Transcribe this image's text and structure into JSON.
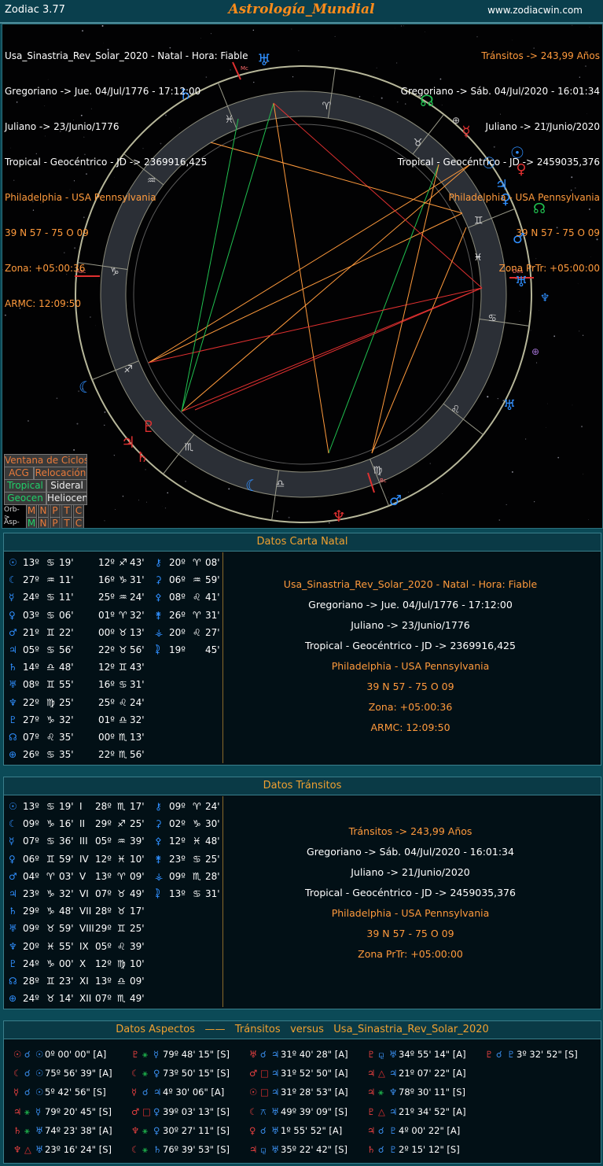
{
  "titlebar": {
    "app": "Zodiac 3.77",
    "title": "Astrología_Mundial",
    "url": "www.zodiacwin.com"
  },
  "natal_header": [
    "Usa_Sinastria_Rev_Solar_2020 - Natal - Hora: Fiable",
    "Gregoriano -> Jue. 04/Jul/1776 - 17:12:00",
    "Juliano -> 23/Junio/1776",
    "Tropical - Geocéntrico - JD -> 2369916,425",
    "Philadelphia - USA Pennsylvania",
    "39 N 57 - 75 O 09",
    "Zona: +05:00:36",
    "ARMC: 12:09:50"
  ],
  "transit_header": [
    "Tránsitos -> 243,99 Años",
    "Gregoriano -> Sáb. 04/Jul/2020 - 16:01:34",
    "Juliano -> 21/Junio/2020",
    "Tropical - Geocéntrico - JD -> 2459035,376",
    "Philadelphia - USA Pennsylvania",
    "39 N 57 - 75 O 09",
    "Zona PrTr: +05:00:00"
  ],
  "wheel_labels": {
    "mc": "Mc",
    "asc": "Asc",
    "des": "Des",
    "bc": "Bc"
  },
  "buttons": {
    "ventana": "Ventana de Ciclos",
    "acg": "ACG",
    "relocacion": "Relocación",
    "tropical": "Tropical",
    "sideral": "Sideral",
    "geocen": "Geocen",
    "heliocen": "Heliocen",
    "orb": "Orb->",
    "asp": "Asp->",
    "m": "M",
    "n": "N",
    "p": "P",
    "t": "T",
    "c": "C"
  },
  "natal_panel": {
    "title": "Datos Carta Natal",
    "col1": [
      [
        "☉",
        "13º",
        "♋",
        "19'"
      ],
      [
        "☾",
        "27º",
        "♒",
        "11'"
      ],
      [
        "☿",
        "24º",
        "♋",
        "11'"
      ],
      [
        "♀",
        "03º",
        "♋",
        "06'"
      ],
      [
        "♂",
        "21º",
        "♊",
        "22'"
      ],
      [
        "♃",
        "05º",
        "♋",
        "56'"
      ],
      [
        "♄",
        "14º",
        "♎",
        "48'"
      ],
      [
        "♅",
        "08º",
        "♊",
        "55'"
      ],
      [
        "♆",
        "22º",
        "♍",
        "25'"
      ],
      [
        "♇",
        "27º",
        "♑",
        "32'"
      ],
      [
        "☊",
        "07º",
        "♌",
        "35'"
      ],
      [
        "⊕",
        "26º",
        "♋",
        "35'"
      ]
    ],
    "col2": [
      [
        "12º",
        "♐",
        "43'"
      ],
      [
        "16º",
        "♑",
        "31'"
      ],
      [
        "25º",
        "♒",
        "24'"
      ],
      [
        "01º",
        "♈",
        "32'"
      ],
      [
        "00º",
        "♉",
        "13'"
      ],
      [
        "22º",
        "♉",
        "56'"
      ],
      [
        "12º",
        "♊",
        "43'"
      ],
      [
        "16º",
        "♋",
        "31'"
      ],
      [
        "25º",
        "♌",
        "24'"
      ],
      [
        "01º",
        "♎",
        "32'"
      ],
      [
        "00º",
        "♏",
        "13'"
      ],
      [
        "22º",
        "♏",
        "56'"
      ]
    ],
    "col3": [
      [
        "⚷",
        "20º",
        "♈",
        "08'"
      ],
      [
        "⚳",
        "06º",
        "♒",
        "59'"
      ],
      [
        "⚴",
        "08º",
        "♌",
        "41'"
      ],
      [
        "⚵",
        "26º",
        "♈",
        "31'"
      ],
      [
        "⚶",
        "20º",
        "♌",
        "27'"
      ],
      [
        "⯝",
        "19º",
        "",
        "45'"
      ]
    ],
    "info": [
      "Usa_Sinastria_Rev_Solar_2020 - Natal - Hora: Fiable",
      "Gregoriano -> Jue. 04/Jul/1776 - 17:12:00",
      "Juliano -> 23/Junio/1776",
      "Tropical - Geocéntrico - JD -> 2369916,425",
      "Philadelphia - USA Pennsylvania",
      "39 N 57 - 75 O 09",
      "Zona: +05:00:36",
      "ARMC: 12:09:50"
    ]
  },
  "transit_panel": {
    "title": "Datos Tránsitos",
    "col1": [
      [
        "☉",
        "13º",
        "♋",
        "19'"
      ],
      [
        "☾",
        "09º",
        "♑",
        "16'"
      ],
      [
        "☿",
        "07º",
        "♋",
        "36'"
      ],
      [
        "♀",
        "06º",
        "♊",
        "59'"
      ],
      [
        "♂",
        "04º",
        "♈",
        "03'"
      ],
      [
        "♃",
        "23º",
        "♑",
        "32'"
      ],
      [
        "♄",
        "29º",
        "♑",
        "48'"
      ],
      [
        "♅",
        "09º",
        "♉",
        "59'"
      ],
      [
        "♆",
        "20º",
        "♓",
        "55'"
      ],
      [
        "♇",
        "24º",
        "♑",
        "00'"
      ],
      [
        "☊",
        "28º",
        "♊",
        "23'"
      ],
      [
        "⊕",
        "24º",
        "♉",
        "14'"
      ]
    ],
    "col2": [
      [
        "I",
        "28º",
        "♏",
        "17'"
      ],
      [
        "II",
        "29º",
        "♐",
        "25'"
      ],
      [
        "III",
        "05º",
        "♒",
        "39'"
      ],
      [
        "IV",
        "12º",
        "♓",
        "10'"
      ],
      [
        "V",
        "13º",
        "♈",
        "09'"
      ],
      [
        "VI",
        "07º",
        "♉",
        "49'"
      ],
      [
        "VII",
        "28º",
        "♉",
        "17'"
      ],
      [
        "VIII",
        "29º",
        "♊",
        "25'"
      ],
      [
        "IX",
        "05º",
        "♌",
        "39'"
      ],
      [
        "X",
        "12º",
        "♍",
        "10'"
      ],
      [
        "XI",
        "13º",
        "♎",
        "09'"
      ],
      [
        "XII",
        "07º",
        "♏",
        "49'"
      ]
    ],
    "col3": [
      [
        "⚷",
        "09º",
        "♈",
        "24'"
      ],
      [
        "⚳",
        "02º",
        "♑",
        "30'"
      ],
      [
        "⚴",
        "12º",
        "♓",
        "48'"
      ],
      [
        "⚵",
        "23º",
        "♋",
        "25'"
      ],
      [
        "⚶",
        "09º",
        "♏",
        "28'"
      ],
      [
        "⯝",
        "13º",
        "♋",
        "31'"
      ]
    ],
    "info": [
      "Tránsitos -> 243,99 Años",
      "Gregoriano -> Sáb. 04/Jul/2020 - 16:01:34",
      "Juliano -> 21/Junio/2020",
      "Tropical - Geocéntrico - JD -> 2459035,376",
      "Philadelphia - USA Pennsylvania",
      "39 N 57 - 75 O 09",
      "Zona PrTr: +05:00:00"
    ]
  },
  "aspects_panel": {
    "title_a": "Datos Aspectos",
    "title_sep": "——",
    "title_b": "Tránsitos",
    "title_c": "versus",
    "title_d": "Usa_Sinastria_Rev_Solar_2020",
    "rows": [
      [
        [
          "☉",
          "☌",
          "☉",
          "0º 00' 00\" [A]"
        ],
        [
          "♇",
          "⚹",
          "☿",
          "79º 48' 15\" [S]"
        ],
        [
          "♅",
          "☌",
          "♃",
          "31º 40' 28\" [A]"
        ],
        [
          "♇",
          "⚼",
          "♅",
          "34º 55' 14\" [A]"
        ],
        [
          "♇",
          "☌",
          "♇",
          "3º 32' 52\" [S]"
        ]
      ],
      [
        [
          "☾",
          "☌",
          "☉",
          "75º 56' 39\" [A]"
        ],
        [
          "☾",
          "⚹",
          "♀",
          "73º 50' 15\" [S]"
        ],
        [
          "♂",
          "□",
          "♃",
          "31º 52' 50\" [A]"
        ],
        [
          "♃",
          "△",
          "♃",
          "21º 07' 22\" [A]"
        ],
        [
          "",
          "",
          "",
          ""
        ]
      ],
      [
        [
          "☿",
          "☌",
          "☉",
          "5º 42' 56\" [S]"
        ],
        [
          "☿",
          "☌",
          "♃",
          "4º 30' 06\" [A]"
        ],
        [
          "☉",
          "□",
          "♃",
          "31º 28' 53\" [A]"
        ],
        [
          "♃",
          "⚹",
          "♆",
          "78º 30' 11\" [S]"
        ],
        [
          "",
          "",
          "",
          ""
        ]
      ],
      [
        [
          "♃",
          "⚹",
          "☿",
          "79º 20' 45\" [S]"
        ],
        [
          "♂",
          "□",
          "♀",
          "39º 03' 13\" [S]"
        ],
        [
          "☾",
          "⚻",
          "♅",
          "49º 39' 09\" [S]"
        ],
        [
          "♇",
          "△",
          "♃",
          "21º 34' 52\" [A]"
        ],
        [
          "",
          "",
          "",
          ""
        ]
      ],
      [
        [
          "♄",
          "⚹",
          "♅",
          "74º 23' 38\" [A]"
        ],
        [
          "♆",
          "⚹",
          "♀",
          "30º 27' 11\" [S]"
        ],
        [
          "♀",
          "☌",
          "♅",
          "1º 55' 52\" [A]"
        ],
        [
          "♃",
          "☌",
          "♇",
          "4º 00' 22\" [A]"
        ],
        [
          "",
          "",
          "",
          ""
        ]
      ],
      [
        [
          "♆",
          "△",
          "♅",
          "23º 16' 24\" [S]"
        ],
        [
          "☾",
          "⚹",
          "♄",
          "76º 39' 53\" [S]"
        ],
        [
          "♃",
          "⚼",
          "♅",
          "35º 22' 42\" [S]"
        ],
        [
          "♄",
          "☌",
          "♇",
          "2º 15' 12\" [S]"
        ],
        [
          "",
          "",
          "",
          ""
        ]
      ]
    ]
  }
}
